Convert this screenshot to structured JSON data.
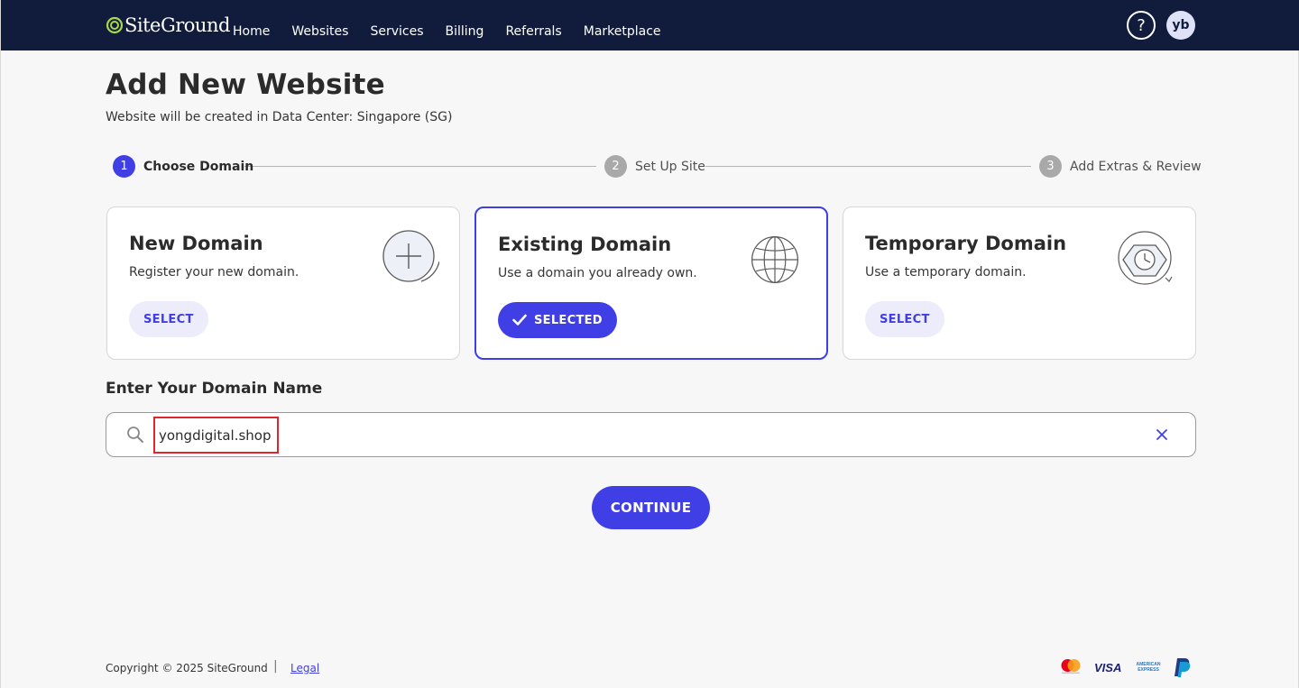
{
  "nav": {
    "brand": "SiteGround",
    "items": [
      "Home",
      "Websites",
      "Services",
      "Billing",
      "Referrals",
      "Marketplace"
    ],
    "help_label": "?",
    "avatar_initials": "yb"
  },
  "page": {
    "title": "Add New Website",
    "subtitle": "Website will be created in Data Center: Singapore (SG)"
  },
  "steps": [
    {
      "num": "1",
      "label": "Choose Domain",
      "state": "active"
    },
    {
      "num": "2",
      "label": "Set Up Site",
      "state": "inactive"
    },
    {
      "num": "3",
      "label": "Add Extras & Review",
      "state": "inactive"
    }
  ],
  "cards": [
    {
      "title": "New Domain",
      "desc": "Register your new domain.",
      "button": "SELECT",
      "icon": "plus-circle-icon",
      "selected": false
    },
    {
      "title": "Existing Domain",
      "desc": "Use a domain you already own.",
      "button": "SELECTED",
      "icon": "globe-icon",
      "selected": true
    },
    {
      "title": "Temporary Domain",
      "desc": "Use a temporary domain.",
      "button": "SELECT",
      "icon": "clock-hexagon-icon",
      "selected": false
    }
  ],
  "domain": {
    "label": "Enter Your Domain Name",
    "value": "yongdigital.shop"
  },
  "continue_label": "CONTINUE",
  "footer": {
    "copyright": "Copyright © 2025 SiteGround",
    "separator": "|",
    "legal": "Legal",
    "payments": [
      "mastercard-icon",
      "visa-icon",
      "amex-icon",
      "paypal-icon"
    ],
    "visa_text": "VISA",
    "amex_text": "AMERICAN EXPRESS"
  },
  "colors": {
    "nav_bg": "#111c3c",
    "accent": "#3f3fe5",
    "highlight": "#e0252f"
  }
}
